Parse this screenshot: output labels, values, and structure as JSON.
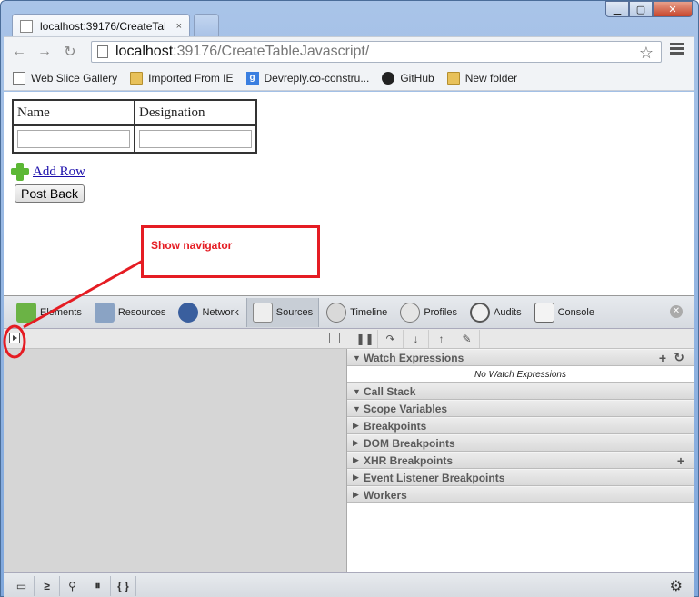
{
  "window": {
    "tab_title": "localhost:39176/CreateTal",
    "tab_close": "×",
    "min": "▁",
    "max": "▢",
    "close": "✕"
  },
  "toolbar": {
    "back_icon": "←",
    "forward_icon": "→",
    "reload_icon": "↻",
    "url_host": "localhost",
    "url_path": ":39176/CreateTableJavascript/",
    "star_icon": "☆"
  },
  "bookmarks": [
    {
      "label": "Web Slice Gallery",
      "icon": "page-icon"
    },
    {
      "label": "Imported From IE",
      "icon": "folder-icon"
    },
    {
      "label": "Devreply.co-constru...",
      "icon": "google-icon"
    },
    {
      "label": "GitHub",
      "icon": "github-icon"
    },
    {
      "label": "New folder",
      "icon": "folder-icon"
    }
  ],
  "page": {
    "col1": "Name",
    "col2": "Designation",
    "add_row": "Add Row",
    "post_back": "Post Back"
  },
  "annotation": {
    "text": "Show navigator",
    "color": "#e51c23"
  },
  "devtools": {
    "tabs": [
      {
        "label": "Elements",
        "icon": "elements-icon",
        "active": false
      },
      {
        "label": "Resources",
        "icon": "resources-icon",
        "active": false
      },
      {
        "label": "Network",
        "icon": "network-icon",
        "active": false
      },
      {
        "label": "Sources",
        "icon": "sources-icon",
        "active": true
      },
      {
        "label": "Timeline",
        "icon": "timeline-icon",
        "active": false
      },
      {
        "label": "Profiles",
        "icon": "profiles-icon",
        "active": false
      },
      {
        "label": "Audits",
        "icon": "audits-icon",
        "active": false
      },
      {
        "label": "Console",
        "icon": "console-icon",
        "active": false
      }
    ],
    "sections": {
      "watch": "Watch Expressions",
      "watch_empty": "No Watch Expressions",
      "call_stack": "Call Stack",
      "scope": "Scope Variables",
      "breakpoints": "Breakpoints",
      "dom_breakpoints": "DOM Breakpoints",
      "xhr_breakpoints": "XHR Breakpoints",
      "event_breakpoints": "Event Listener Breakpoints",
      "workers": "Workers"
    },
    "debug": {
      "pause": "❚❚",
      "step_over": "↷",
      "step_into": "↓",
      "step_out": "↑",
      "deactivate": "✎"
    },
    "status": {
      "dock": "▭",
      "console": "≥",
      "search": "⚲",
      "pause_exc": "⏸",
      "pretty": "{ }",
      "gear": "⚙"
    }
  }
}
